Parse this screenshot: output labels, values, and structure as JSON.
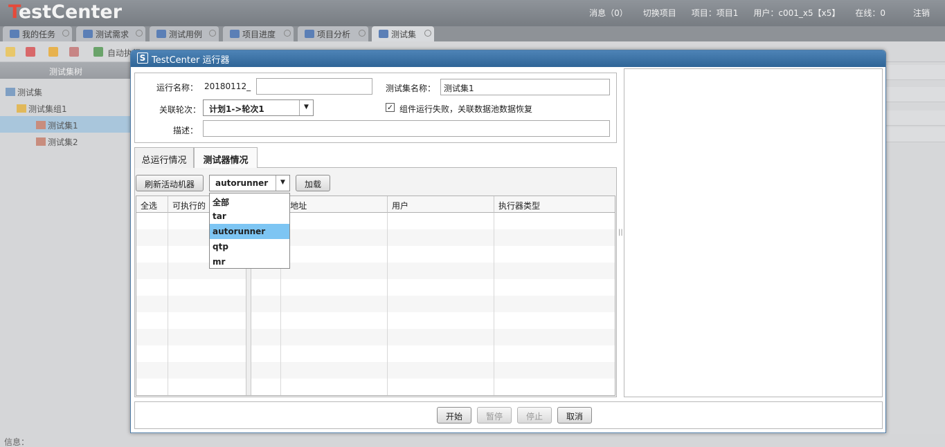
{
  "app": {
    "logo": "TestCenter",
    "logo_first": "T",
    "logo_rest": "estCenter",
    "top_links": [
      "消息（0）",
      "切换项目",
      "项目：项目1",
      "用户：c001_x5【x5】",
      "在线：0",
      "注销"
    ]
  },
  "nav_tabs": [
    {
      "label": "我的任务"
    },
    {
      "label": "测试需求"
    },
    {
      "label": "测试用例"
    },
    {
      "label": "项目进度"
    },
    {
      "label": "项目分析"
    },
    {
      "label": "测试集"
    }
  ],
  "toolbar": {
    "auto_label": "自动执行"
  },
  "left_panel": {
    "title": "测试集树",
    "tree": [
      "测试集",
      "测试集组1",
      "测试集1",
      "测试集2"
    ]
  },
  "status": {
    "label": "信息："
  },
  "dialog": {
    "title": "TestCenter 运行器",
    "run_name_label": "运行名称：",
    "run_name_prefix": "20180112_",
    "run_name_value": "",
    "set_name_label": "测试集名称：",
    "set_name_value": "测试集1",
    "round_label": "关联轮次：",
    "round_value": "计划1->轮次1",
    "recover_label": "组件运行失败，关联数据池数据恢复",
    "recover_checked": "✓",
    "desc_label": "描述：",
    "desc_value": "",
    "tabs": [
      "总运行情况",
      "测试器情况"
    ],
    "refresh_button": "刷新活动机器",
    "engine_value": "autorunner",
    "load_button": "加载",
    "columns": [
      "全选",
      "可执行的",
      "P地址",
      "用户",
      "执行器类型"
    ],
    "dropdown_options": [
      "全部",
      "tar",
      "autorunner",
      "qtp",
      "mr"
    ],
    "dropdown_highlight": "autorunner",
    "start_button": "开始",
    "pause_button": "暂停",
    "stop_button": "停止",
    "cancel_button": "取消"
  },
  "colors": {
    "title_bar": "#3a72a6",
    "highlight": "#7dc5f3"
  }
}
